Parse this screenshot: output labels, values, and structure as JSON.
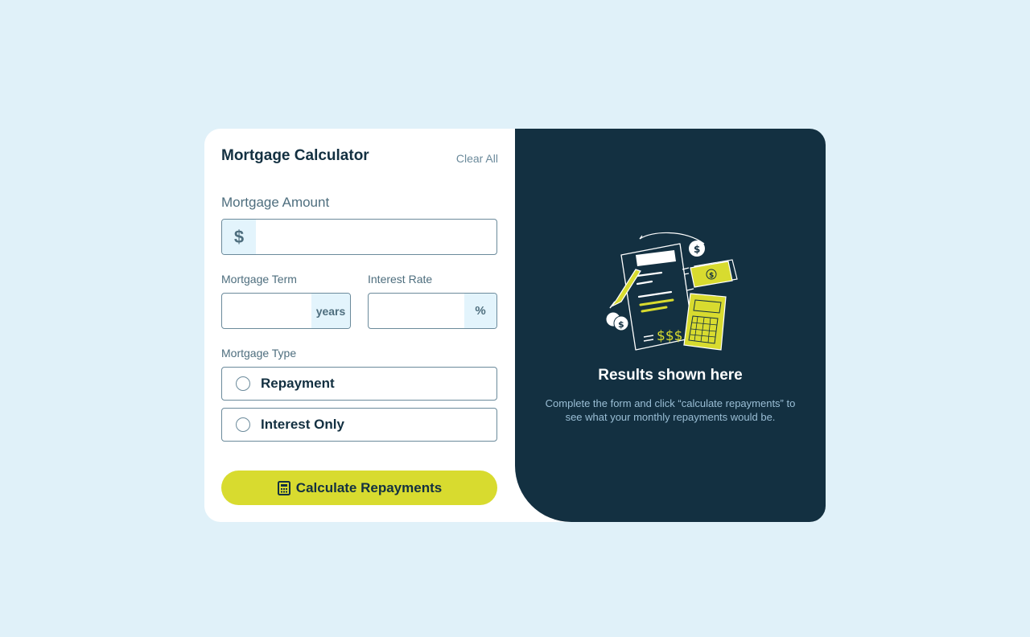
{
  "form": {
    "title": "Mortgage Calculator",
    "clear_all": "Clear All",
    "amount": {
      "label": "Mortgage Amount",
      "prefix": "$",
      "value": "",
      "placeholder": ""
    },
    "term": {
      "label": "Mortgage Term",
      "suffix": "years",
      "value": "",
      "placeholder": ""
    },
    "rate": {
      "label": "Interest Rate",
      "suffix": "%",
      "value": "",
      "placeholder": ""
    },
    "type": {
      "label": "Mortgage Type",
      "options": [
        "Repayment",
        "Interest Only"
      ],
      "selected": null
    },
    "submit_label": "Calculate Repayments"
  },
  "results": {
    "title": "Results shown here",
    "description": "Complete the form and click “calculate repayments” to see what your monthly repayments would be.",
    "illustration_icon": "empty-results-illustration"
  },
  "colors": {
    "background": "#e0f1f9",
    "panel_dark": "#133041",
    "accent_lime": "#d8db2f",
    "border": "#6b8a9b",
    "addon_bg": "#e3f4fc"
  }
}
